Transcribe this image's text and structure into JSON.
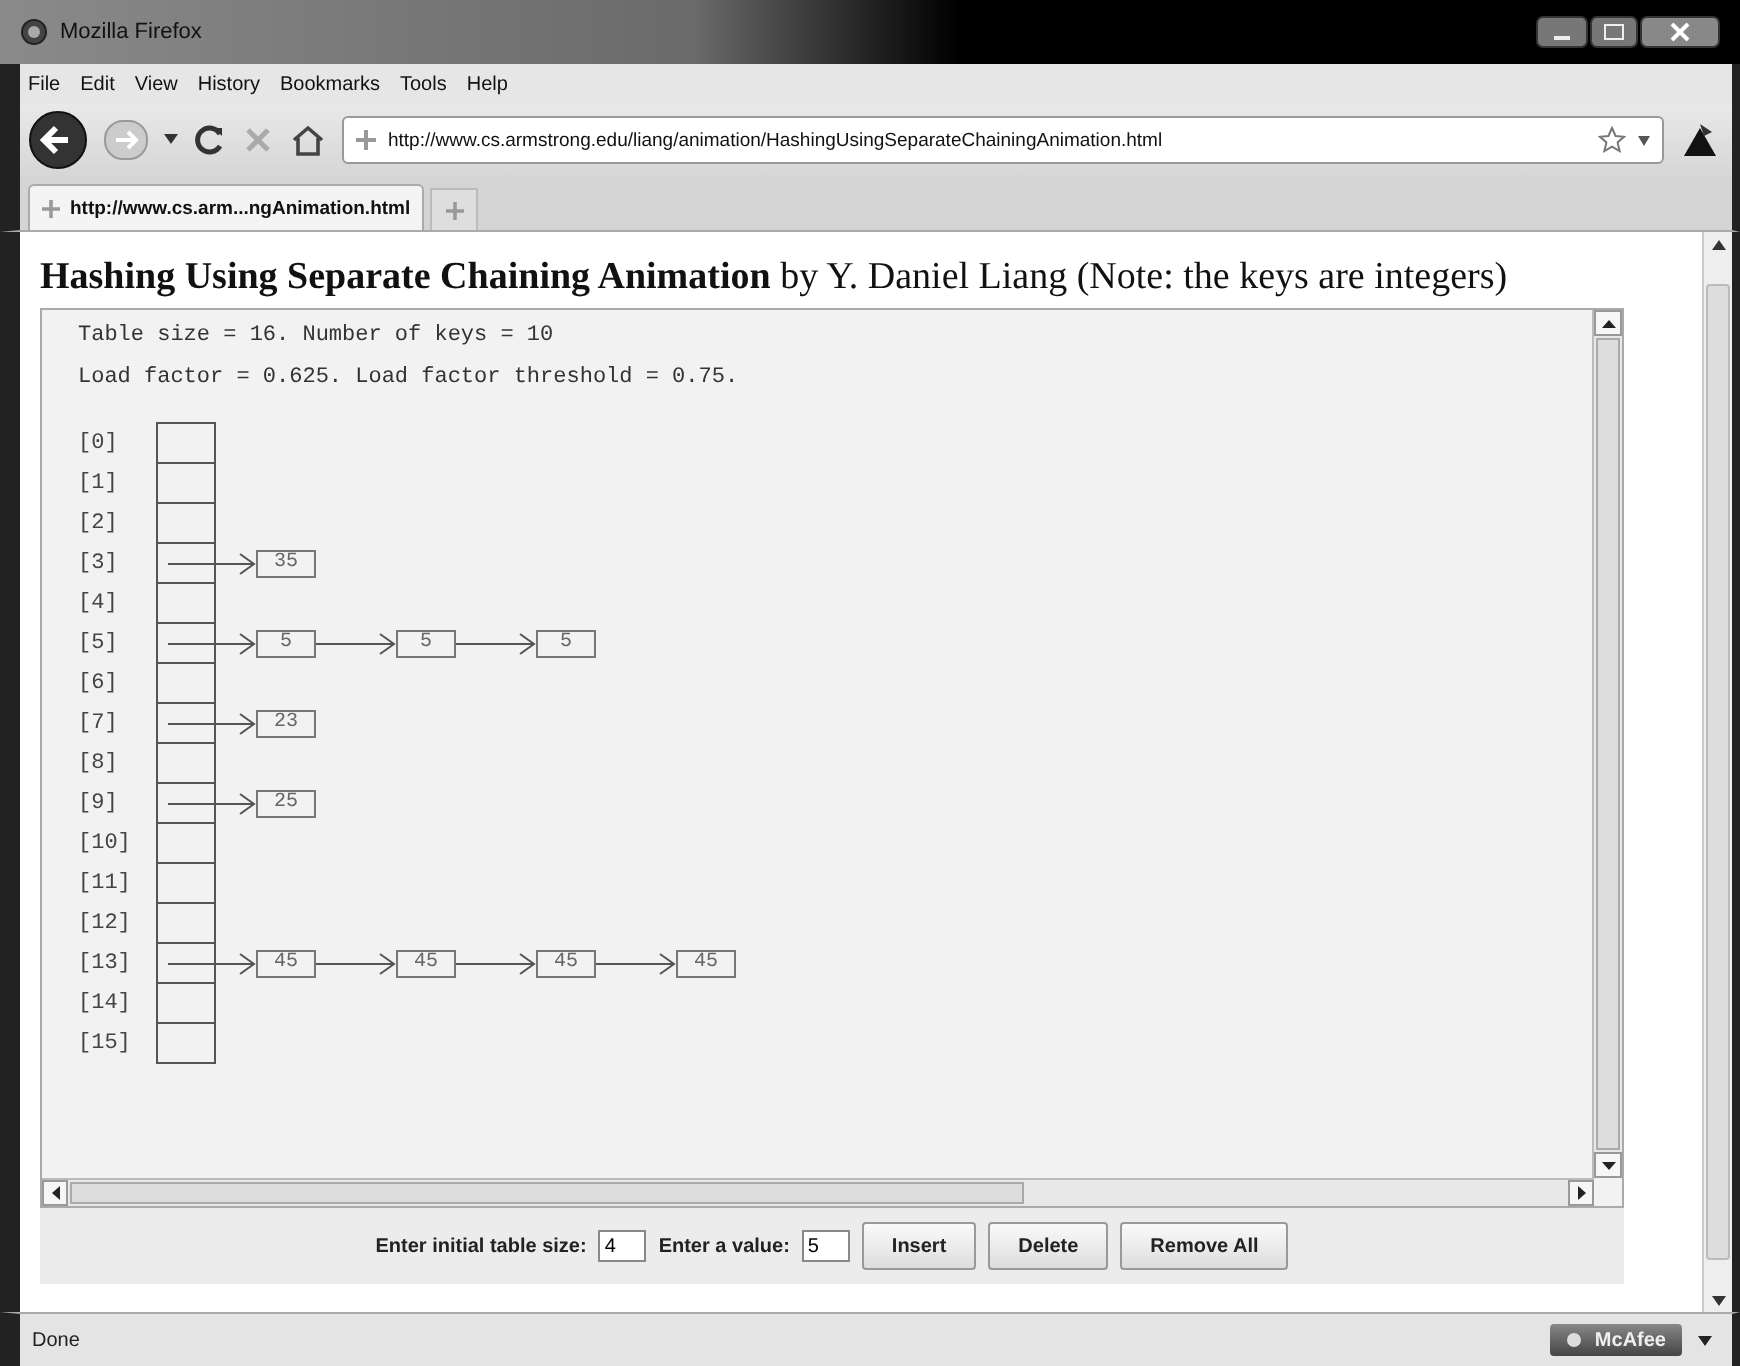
{
  "window": {
    "title": "Mozilla Firefox"
  },
  "menu": [
    "File",
    "Edit",
    "View",
    "History",
    "Bookmarks",
    "Tools",
    "Help"
  ],
  "address": "http://www.cs.armstrong.edu/liang/animation/HashingUsingSeparateChainingAnimation.html",
  "tabs": [
    {
      "label": "http://www.cs.arm...ngAnimation.html",
      "selected": true
    }
  ],
  "page": {
    "heading": "**Hashing Using Separate Chaining Animation** by Y. Daniel Liang (Note: the keys are integers)"
  },
  "applet": {
    "info": [
      "Table size = 16. Number of keys = 10",
      "Load factor = 0.625. Load factor threshold = 0.75."
    ],
    "buckets": [
      {
        "label": "[0]"
      },
      {
        "label": "[1]"
      },
      {
        "label": "[2]"
      },
      {
        "label": "[3]",
        "chain": [
          "35"
        ]
      },
      {
        "label": "[4]"
      },
      {
        "label": "[5]",
        "chain": [
          "5",
          "5",
          "5"
        ]
      },
      {
        "label": "[6]"
      },
      {
        "label": "[7]",
        "chain": [
          "23"
        ]
      },
      {
        "label": "[8]"
      },
      {
        "label": "[9]",
        "chain": [
          "25"
        ]
      },
      {
        "label": "[10]"
      },
      {
        "label": "[11]"
      },
      {
        "label": "[12]"
      },
      {
        "label": "[13]",
        "chain": [
          "45",
          "45",
          "45",
          "45"
        ]
      },
      {
        "label": "[14]"
      },
      {
        "label": "[15]"
      }
    ]
  },
  "controls": {
    "size_label": "Enter initial table size:",
    "size_value": "4",
    "value_label": "Enter a value:",
    "value_value": "5",
    "buttons": [
      "Insert",
      "Delete",
      "Remove All"
    ]
  },
  "status_bar": {
    "text": "Done",
    "addon": "McAfee"
  }
}
